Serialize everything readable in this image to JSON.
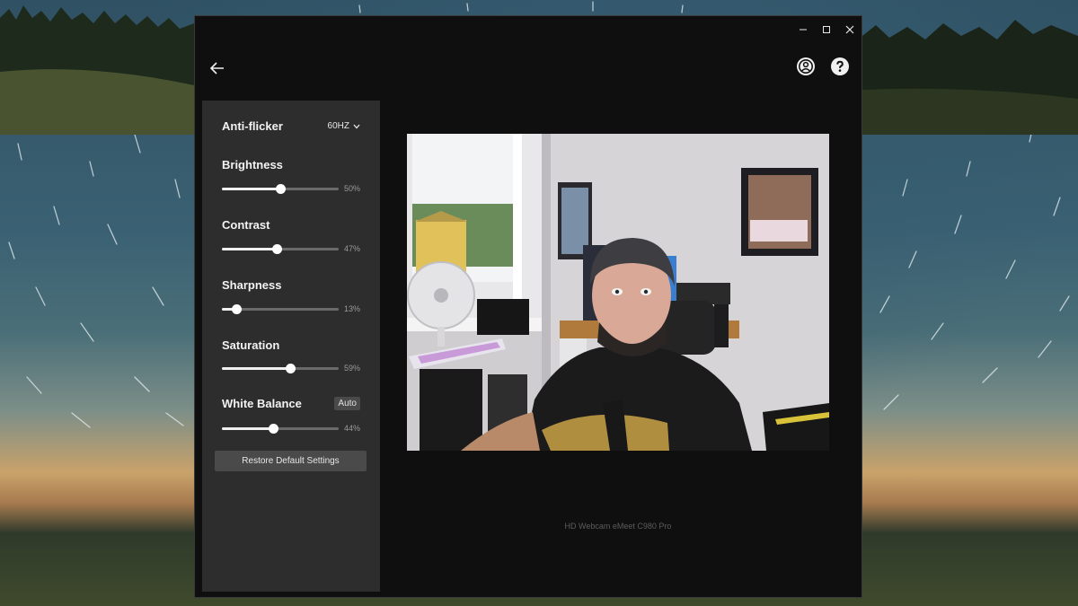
{
  "window": {
    "controls": [
      "minimize-icon",
      "maximize-icon",
      "close-icon"
    ],
    "top_icons": [
      "account-icon",
      "help-icon"
    ]
  },
  "settings": {
    "anti_flicker": {
      "label": "Anti-flicker",
      "value": "60HZ"
    },
    "sliders": [
      {
        "label": "Brightness",
        "percent": 50,
        "value_text": "50%"
      },
      {
        "label": "Contrast",
        "percent": 47,
        "value_text": "47%"
      },
      {
        "label": "Sharpness",
        "percent": 13,
        "value_text": "13%"
      },
      {
        "label": "Saturation",
        "percent": 59,
        "value_text": "59%"
      },
      {
        "label": "White Balance",
        "percent": 44,
        "value_text": "44%",
        "badge": "Auto"
      }
    ],
    "restore_label": "Restore Default Settings"
  },
  "device_name": "HD Webcam eMeet C980 Pro",
  "colors": {
    "window_bg": "#0f0f0f",
    "panel_bg": "#2d2d2d",
    "button_bg": "#4a4a4a"
  }
}
